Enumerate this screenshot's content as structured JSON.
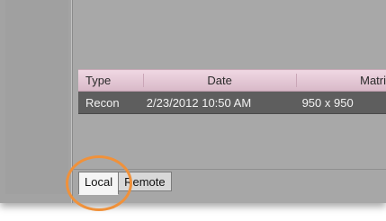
{
  "grid": {
    "columns": [
      "Type",
      "Date",
      "Matri"
    ],
    "rows": [
      {
        "type": "Recon",
        "date": "2/23/2012 10:50 AM",
        "matrix": "950 x 950"
      }
    ]
  },
  "tabs": [
    {
      "label": "Local",
      "active": true
    },
    {
      "label": "Remote",
      "active": false
    }
  ],
  "colors": {
    "highlight": "#f0913a",
    "header": "#e8cbd8",
    "selected_row": "#5e5e5e"
  }
}
